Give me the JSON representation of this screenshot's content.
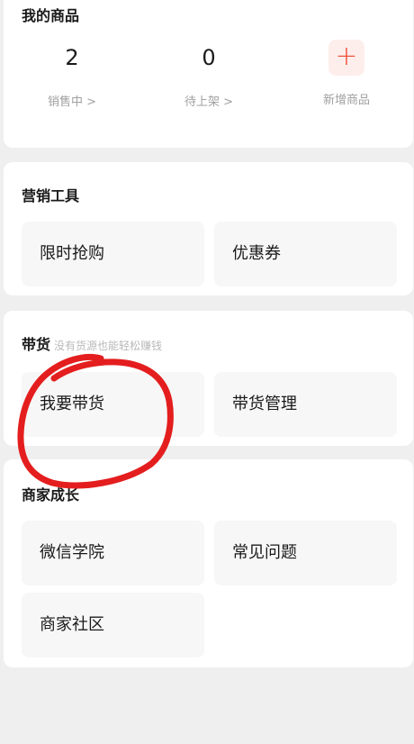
{
  "products": {
    "title": "我的商品",
    "selling": {
      "value": "2",
      "label": "销售中 >"
    },
    "pending": {
      "value": "0",
      "label": "待上架 >"
    },
    "add": {
      "symbol": "+",
      "label": "新增商品"
    }
  },
  "marketing": {
    "title": "营销工具",
    "items": [
      "限时抢购",
      "优惠券"
    ]
  },
  "sell": {
    "title": "带货",
    "subtitle": "没有货源也能轻松赚钱",
    "items": [
      "我要带货",
      "带货管理"
    ]
  },
  "growth": {
    "title": "商家成长",
    "items": [
      "微信学院",
      "常见问题",
      "商家社区"
    ]
  },
  "colors": {
    "accent": "#f0533e",
    "annotation": "#e41e1e",
    "background": "#efefef",
    "tile": "#f7f7f7"
  },
  "annotation": {
    "shape": "hand-drawn-circle",
    "target": "我要带货"
  }
}
